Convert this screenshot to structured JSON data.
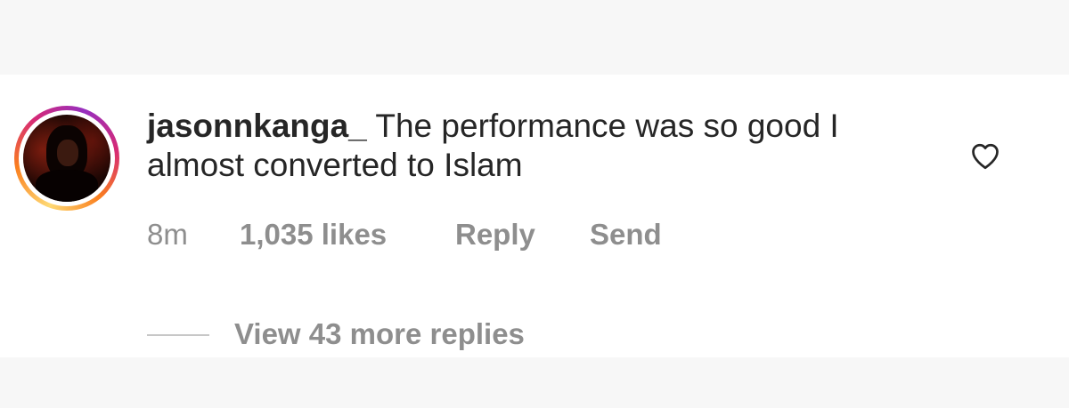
{
  "comment": {
    "username": "jasonnkanga_",
    "text": " The performance was so good I almost converted to Islam",
    "time": "8m",
    "likes": "1,035 likes",
    "reply_label": "Reply",
    "send_label": "Send",
    "view_replies_label": "View 43 more replies",
    "like_icon": "heart-outline",
    "avatar_has_story_ring": true
  },
  "colors": {
    "text_primary": "#262626",
    "text_secondary": "#8e8e8e",
    "background": "#ffffff",
    "band_background": "#f7f7f7"
  }
}
